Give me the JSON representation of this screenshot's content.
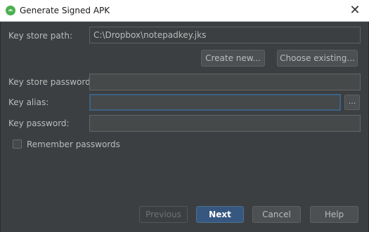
{
  "window": {
    "title": "Generate Signed APK",
    "close_glyph": "✕",
    "app_icon": "android-studio-icon"
  },
  "form": {
    "key_store_path_label": "Key store path:",
    "key_store_path_value": "C:\\Dropbox\\notepadkey.jks",
    "create_new_label": "Create new...",
    "choose_existing_label": "Choose existing...",
    "key_store_password_label": "Key store password:",
    "key_store_password_value": "",
    "key_alias_label": "Key alias:",
    "key_alias_value": "",
    "ellipsis_label": "...",
    "key_password_label": "Key password:",
    "key_password_value": "",
    "remember_label": "Remember passwords",
    "remember_checked": false
  },
  "footer": {
    "previous_label": "Previous",
    "next_label": "Next",
    "cancel_label": "Cancel",
    "help_label": "Help"
  },
  "colors": {
    "background": "#3c3f41",
    "accent": "#365880",
    "focus_border": "#3d6185",
    "text": "#bbbbbb"
  }
}
